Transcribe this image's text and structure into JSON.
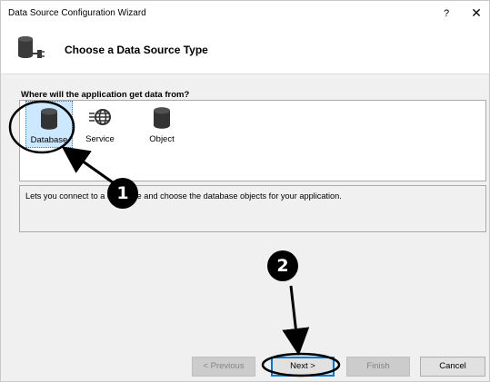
{
  "window": {
    "title": "Data Source Configuration Wizard",
    "help_label": "?",
    "close_label": "✕"
  },
  "header": {
    "title": "Choose a Data Source Type",
    "icon": "data-source-connector-icon"
  },
  "prompt": "Where will the application get data from?",
  "source_types": [
    {
      "label": "Database",
      "icon": "database-icon",
      "selected": true
    },
    {
      "label": "Service",
      "icon": "service-globe-icon",
      "selected": false
    },
    {
      "label": "Object",
      "icon": "object-cylinder-icon",
      "selected": false
    }
  ],
  "description": "Lets you connect to a database and choose the database objects for your application.",
  "buttons": {
    "previous": "< Previous",
    "next": "Next >",
    "finish": "Finish",
    "cancel": "Cancel"
  },
  "annotations": {
    "step1": "1",
    "step2": "2"
  },
  "colors": {
    "selection": "#cce8ff",
    "accent": "#0078d7"
  }
}
